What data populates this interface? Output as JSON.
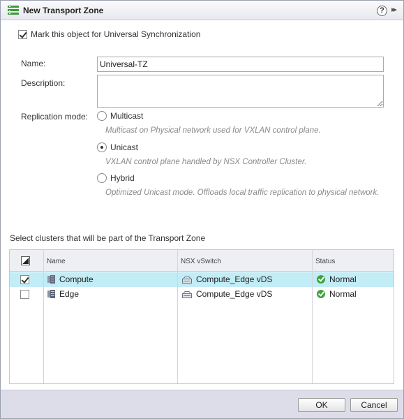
{
  "dialog": {
    "title": "New Transport Zone",
    "help_label": "?",
    "more_label": "▸▸"
  },
  "sync": {
    "label": "Mark this object for Universal Synchronization",
    "checked": true
  },
  "form": {
    "name_label": "Name:",
    "name_value": "Universal-TZ",
    "description_label": "Description:",
    "description_value": "",
    "replication_label": "Replication mode:",
    "replication_options": [
      {
        "label": "Multicast",
        "description": "Multicast on Physical network used for VXLAN control plane.",
        "selected": false
      },
      {
        "label": "Unicast",
        "description": "VXLAN control plane handled by NSX Controller Cluster.",
        "selected": true
      },
      {
        "label": "Hybrid",
        "description": "Optimized Unicast mode. Offloads local traffic replication to physical network.",
        "selected": false
      }
    ]
  },
  "clusters": {
    "section_label": "Select clusters that will be part of the Transport Zone",
    "columns": [
      "Name",
      "NSX vSwitch",
      "Status"
    ],
    "rows": [
      {
        "name": "Compute",
        "vswitch": "Compute_Edge vDS",
        "status": "Normal",
        "checked": true,
        "selected": true
      },
      {
        "name": "Edge",
        "vswitch": "Compute_Edge vDS",
        "status": "Normal",
        "checked": false,
        "selected": false
      }
    ]
  },
  "footer": {
    "ok_label": "OK",
    "cancel_label": "Cancel"
  },
  "colors": {
    "selected_row": "#c2ecf6",
    "status_ok": "#3fa340",
    "footer_bg": "#dddde9",
    "title_icon": "#3a9a3a"
  },
  "icons": {
    "title": "transport-zone-icon",
    "cluster": "cluster-icon",
    "vswitch": "vswitch-icon",
    "status": "status-ok-icon"
  }
}
